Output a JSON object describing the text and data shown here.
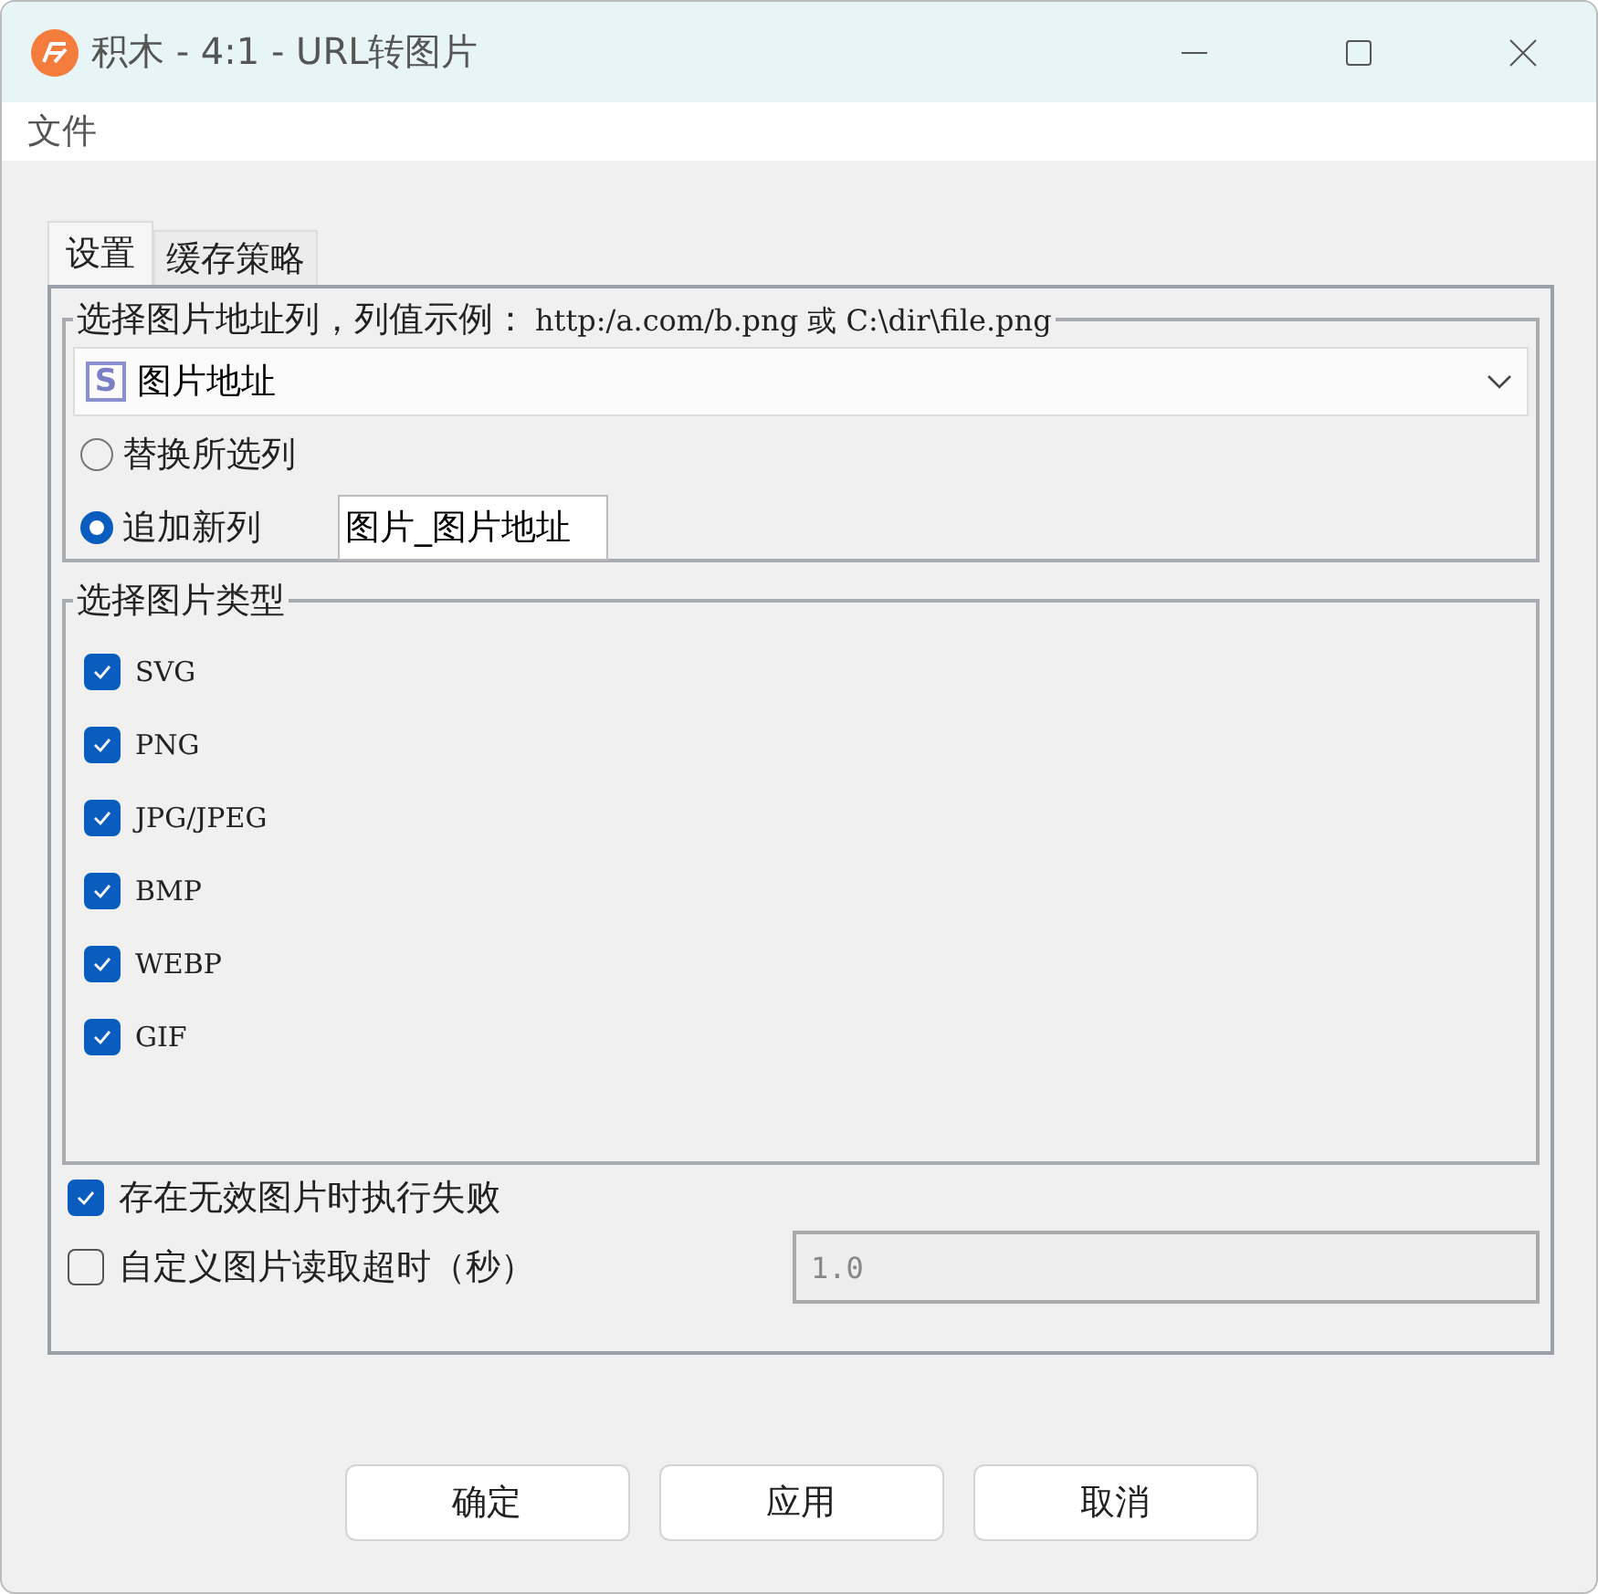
{
  "window": {
    "title": "积木 - 4:1 - URL转图片"
  },
  "menu": [
    "文件"
  ],
  "tabs": [
    {
      "label": "设置",
      "selected": true
    },
    {
      "label": "缓存策略",
      "selected": false
    }
  ],
  "column_group": {
    "legend": "选择图片地址列，列值示例：",
    "example": "http:/a.com/b.png 或 C:\\dir\\file.png",
    "type_badge": "S",
    "column": "图片地址",
    "options": [
      {
        "label": "替换所选列",
        "selected": false
      },
      {
        "label": "追加新列",
        "selected": true,
        "value": "图片_图片地址"
      }
    ]
  },
  "type_group": {
    "legend": "选择图片类型",
    "types": [
      {
        "label": "SVG",
        "checked": true
      },
      {
        "label": "PNG",
        "checked": true
      },
      {
        "label": "JPG/JPEG",
        "checked": true
      },
      {
        "label": "BMP",
        "checked": true
      },
      {
        "label": "WEBP",
        "checked": true
      },
      {
        "label": "GIF",
        "checked": true
      }
    ]
  },
  "fail_on_invalid": {
    "label": "存在无效图片时执行失败",
    "checked": true
  },
  "timeout": {
    "label": "自定义图片读取超时（秒）",
    "checked": false,
    "value": "1.0",
    "disabled": true
  },
  "buttons": [
    "确定",
    "应用",
    "取消"
  ]
}
